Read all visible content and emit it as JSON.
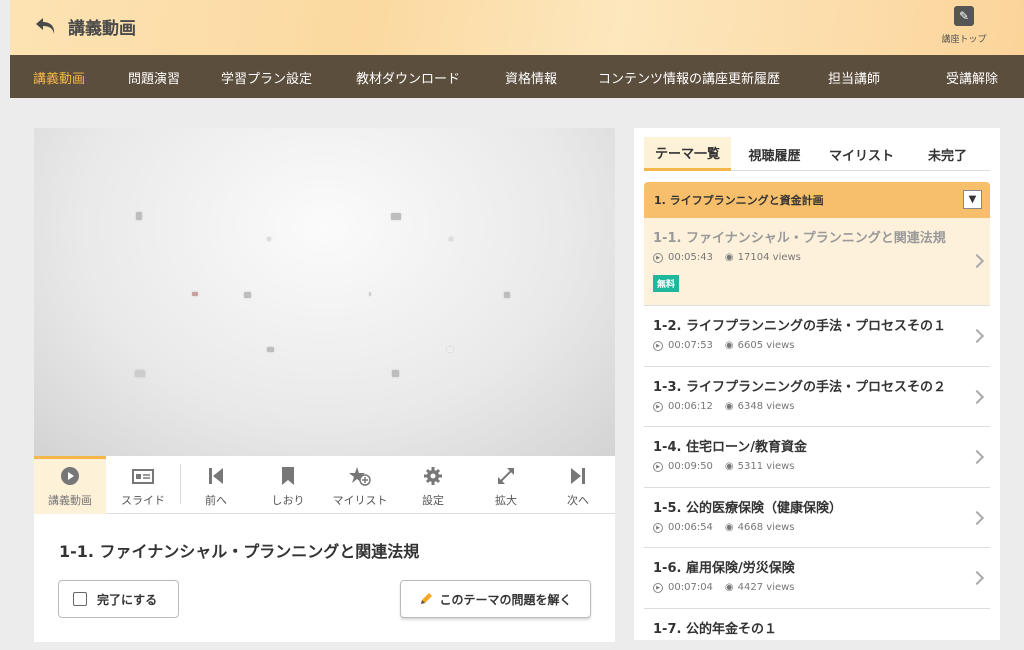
{
  "header": {
    "back_label": "講義動画",
    "top_link_label": "講座トップ"
  },
  "nav": {
    "items": [
      "講義動画",
      "問題演習",
      "学習プラン設定",
      "教材ダウンロード",
      "資格情報",
      "コンテンツ情報の講座更新履歴",
      "担当講師",
      "受講解除"
    ]
  },
  "player": {
    "controls": [
      "講義動画",
      "スライド",
      "前へ",
      "しおり",
      "マイリスト",
      "設定",
      "拡大",
      "次へ"
    ]
  },
  "lesson": {
    "title": "1-1. ファイナンシャル・プランニングと関連法規",
    "done_label": "完了にする",
    "quiz_label": "このテーマの問題を解く"
  },
  "sidebar": {
    "tabs": [
      "テーマ一覧",
      "視聴履歴",
      "マイリスト",
      "未完了"
    ],
    "chapter": "1. ライフプランニングと資金計画",
    "items": [
      {
        "title": "1-1. ファイナンシャル・プランニングと関連法規",
        "duration": "00:05:43",
        "views": "17104 views",
        "badge": "無料"
      },
      {
        "title": "1-2. ライフプランニングの手法・プロセスその１",
        "duration": "00:07:53",
        "views": "6605 views"
      },
      {
        "title": "1-3. ライフプランニングの手法・プロセスその２",
        "duration": "00:06:12",
        "views": "6348 views"
      },
      {
        "title": "1-4. 住宅ローン/教育資金",
        "duration": "00:09:50",
        "views": "5311 views"
      },
      {
        "title": "1-5. 公的医療保険（健康保険）",
        "duration": "00:06:54",
        "views": "4668 views"
      },
      {
        "title": "1-6. 雇用保険/労災保険",
        "duration": "00:07:04",
        "views": "4427 views"
      },
      {
        "title": "1-7. 公的年金その１"
      }
    ]
  }
}
